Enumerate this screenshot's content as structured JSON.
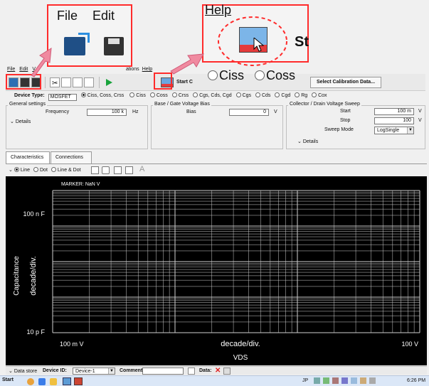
{
  "zoom_left": {
    "file_label": "File",
    "edit_label": "Edit"
  },
  "zoom_right": {
    "help_label": "Help",
    "start_partial": "St",
    "ciss_label": "Ciss",
    "coss_label": "Coss"
  },
  "menubar": {
    "items": [
      "File",
      "Edit",
      "V",
      "ations",
      "Help"
    ]
  },
  "toolbar": {
    "start_partial": "Start C",
    "select_calibration_label": "Select Calibration Data..."
  },
  "setup": {
    "device_type_label": "Device Type:",
    "device_type_value": "MOSFET",
    "radios": [
      "Ciss, Coss, Crss",
      "Ciss",
      "Coss",
      "Crss",
      "Cgs, Cds, Cgd",
      "Cgs",
      "Cds",
      "Cgd",
      "Rg",
      "Cox"
    ],
    "selected_radio_index": 0
  },
  "general_settings": {
    "title": "General settings",
    "frequency_label": "Frequency",
    "frequency_value": "100 k",
    "frequency_unit": "Hz",
    "details_label": "Details"
  },
  "gate_bias": {
    "title": "Base / Gate Voltage Bias",
    "bias_label": "Bias",
    "bias_value": "0",
    "bias_unit": "V"
  },
  "drain_sweep": {
    "title": "Collector / Drain Voltage Sweep",
    "start_label": "Start",
    "start_value": "100 m",
    "start_unit": "V",
    "stop_label": "Stop",
    "stop_value": "100",
    "stop_unit": "V",
    "sweep_mode_label": "Sweep Mode",
    "sweep_mode_value": "LogSingle",
    "details_label": "Details"
  },
  "tabs": [
    {
      "label": "Characteristics"
    },
    {
      "label": "Connections"
    }
  ],
  "plot_controls": {
    "line_label": "Line",
    "dot_label": "Dot",
    "linedot_label": "Line & Dot",
    "selected_style_index": 0
  },
  "chart_data": {
    "type": "line",
    "marker_text": "MARKER: NaN V",
    "ylabel_outer": "Capacitance",
    "ylabel_inner": "decade/div.",
    "xlabel_inner": "decade/div.",
    "xlabel_outer": "VDS",
    "y_ticks": [
      "100 n F",
      "10 p F"
    ],
    "x_ticks": [
      "100 m V",
      "100 V"
    ],
    "series": [],
    "xlim_label": [
      "100 m V",
      "100 V"
    ],
    "ylim_label": [
      "10 p F",
      "100 n F"
    ],
    "x_scale": "log",
    "y_scale": "log",
    "x_decades": 3,
    "y_decades": 4,
    "grid": true
  },
  "statusbar": {
    "data_store_label": "Data store",
    "device_id_label": "Device ID:",
    "device_id_value": "Device-1",
    "comment_label": "Comment:",
    "data_label": "Data:"
  },
  "taskbar": {
    "start_label": "Start",
    "lang": "JP",
    "clock": "6:26 PM"
  }
}
